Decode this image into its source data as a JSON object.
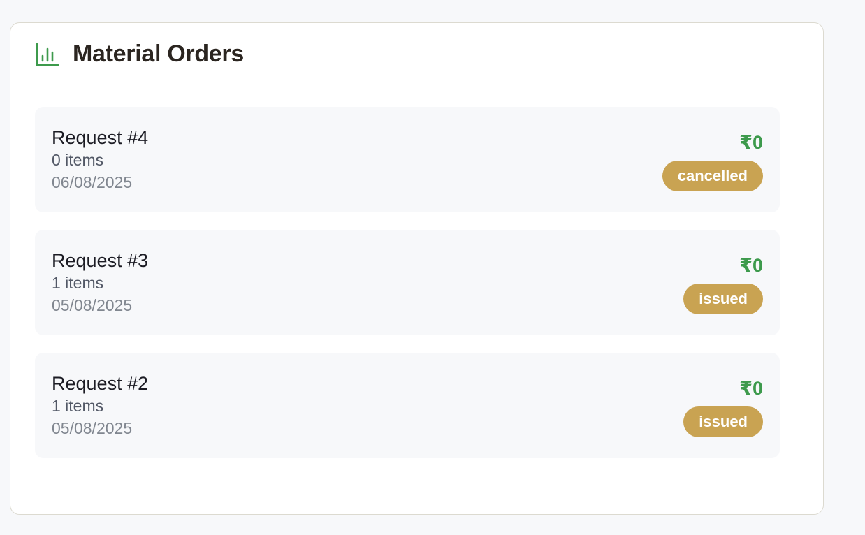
{
  "panel": {
    "title": "Material Orders",
    "icon": "bar-chart-icon",
    "icon_color": "#3d9a4c"
  },
  "orders": [
    {
      "title": "Request #4",
      "items": "0 items",
      "date": "06/08/2025",
      "amount": "₹0",
      "status": "cancelled"
    },
    {
      "title": "Request #3",
      "items": "1 items",
      "date": "05/08/2025",
      "amount": "₹0",
      "status": "issued"
    },
    {
      "title": "Request #2",
      "items": "1 items",
      "date": "05/08/2025",
      "amount": "₹0",
      "status": "issued"
    }
  ],
  "colors": {
    "amount": "#3d9a4c",
    "badge": "#c9a352",
    "row_background": "#f7f8fa"
  }
}
